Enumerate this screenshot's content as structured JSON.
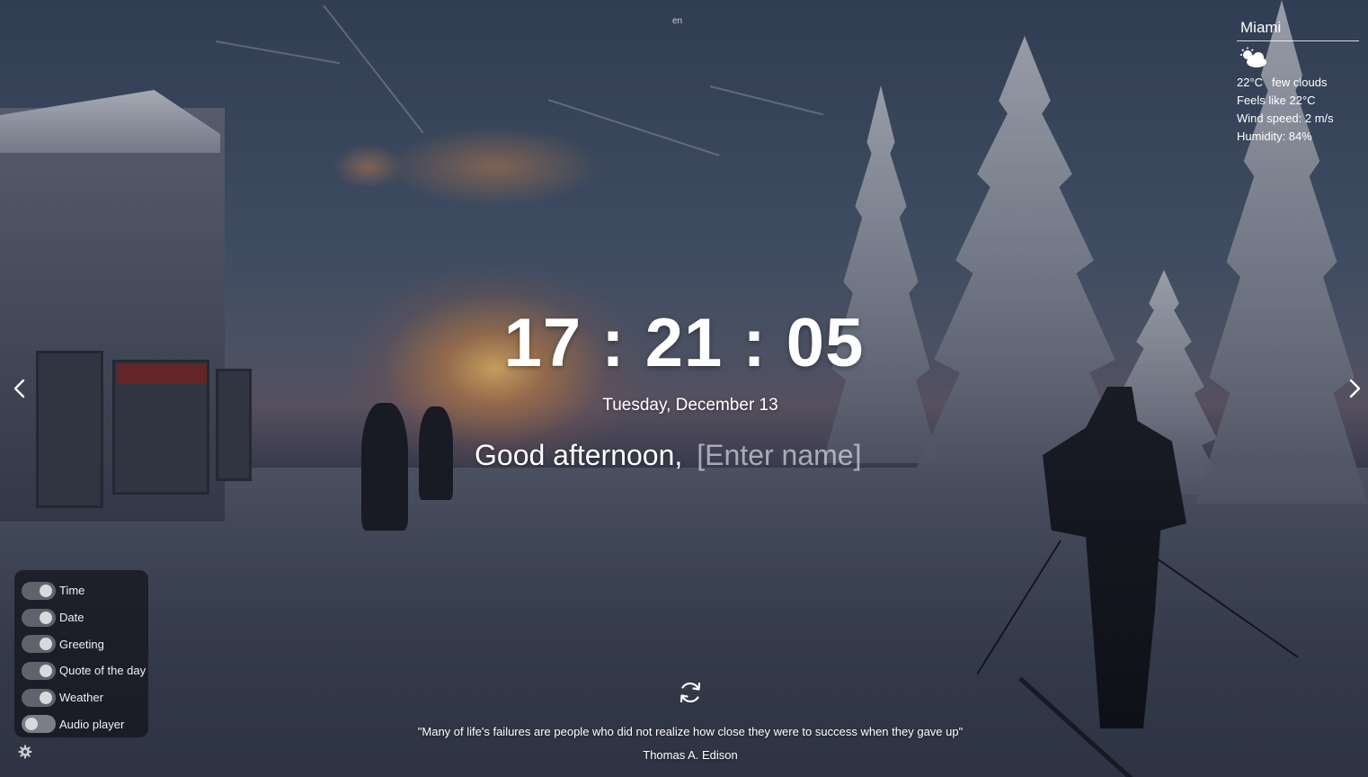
{
  "language": {
    "label": "en"
  },
  "weather": {
    "city": "Miami",
    "icon": "few-clouds-icon",
    "temperature": "22°C",
    "description": "few clouds",
    "feels_like": "Feels like 22°C",
    "wind_speed": "Wind speed: 2 m/s",
    "humidity": "Humidity: 84%"
  },
  "clock": {
    "time": "17 : 21 : 05"
  },
  "date": {
    "text": "Tuesday, December 13"
  },
  "greeting": {
    "text": "Good afternoon,",
    "name_placeholder": "[Enter name]"
  },
  "quote": {
    "text": "\"Many of life's failures are people who did not realize how close they were to success when they gave up\"",
    "author": "Thomas A. Edison"
  },
  "settings": {
    "toggles": [
      {
        "label": "Time",
        "on": true
      },
      {
        "label": "Date",
        "on": true
      },
      {
        "label": "Greeting",
        "on": true
      },
      {
        "label": "Quote of the day",
        "on": true
      },
      {
        "label": "Weather",
        "on": true
      },
      {
        "label": "Audio player",
        "on": false
      }
    ]
  },
  "icons": {
    "prev_slide": "chevron-left-icon",
    "next_slide": "chevron-right-icon",
    "refresh_quote": "refresh-icon",
    "settings": "gear-icon"
  },
  "colors": {
    "text": "#ffffff",
    "panel": "#12141c",
    "toggle_knob": "#d8d9dd"
  }
}
